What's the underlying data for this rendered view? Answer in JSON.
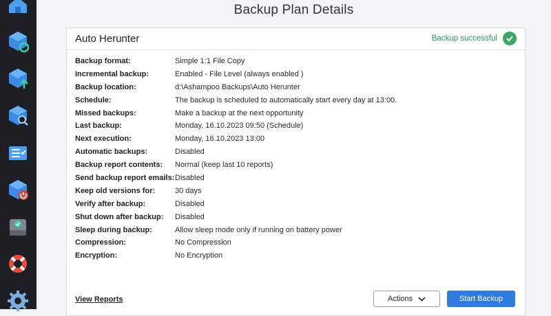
{
  "header": {
    "title": "Backup Plan Details"
  },
  "sidebar": {
    "items": [
      {
        "icon": "home-icon"
      },
      {
        "icon": "restore-icon"
      },
      {
        "icon": "upload-backup-icon"
      },
      {
        "icon": "search-backup-icon"
      },
      {
        "icon": "checklist-icon"
      },
      {
        "icon": "power-backup-icon"
      },
      {
        "icon": "drive-check-icon"
      },
      {
        "icon": "lifebuoy-icon"
      },
      {
        "icon": "settings-gear-icon"
      }
    ]
  },
  "plan": {
    "name": "Auto Herunter",
    "status": "Backup successful",
    "status_color": "#2e9a5a",
    "details": [
      {
        "label": "Backup format:",
        "value": "Simple 1:1 File Copy"
      },
      {
        "label": "Incremental backup:",
        "value": "Enabled - File Level (always enabled )"
      },
      {
        "label": "Backup location:",
        "value": "d:\\Ashampoo Backups\\Auto Herunter"
      },
      {
        "label": "Schedule:",
        "value": "The backup is scheduled to automatically start every day at 13:00."
      },
      {
        "label": "Missed backups:",
        "value": "Make a backup at the next opportunity"
      },
      {
        "label": "Last backup:",
        "value": "Monday, 16.10.2023 09:50 (Schedule)"
      },
      {
        "label": "Next execution:",
        "value": "Monday, 16.10.2023 13:00"
      },
      {
        "label": "Automatic backups:",
        "value": "Disabled"
      },
      {
        "label": "Backup report contents:",
        "value": "Normal (keep last 10 reports)"
      },
      {
        "label": "Send backup report emails:",
        "value": "Disabled"
      },
      {
        "label": "Keep old versions for:",
        "value": "30 days"
      },
      {
        "label": "Verify after backup:",
        "value": "Disabled"
      },
      {
        "label": "Shut down after backup:",
        "value": "Disabled"
      },
      {
        "label": "Sleep during backup:",
        "value": "Allow sleep mode only if running on battery power"
      },
      {
        "label": "Compression:",
        "value": "No Compression"
      },
      {
        "label": "Encryption:",
        "value": "No Encryption"
      }
    ]
  },
  "footer": {
    "view_reports": "View Reports",
    "actions": "Actions",
    "start_backup": "Start Backup",
    "accent": "#2f7de1"
  }
}
